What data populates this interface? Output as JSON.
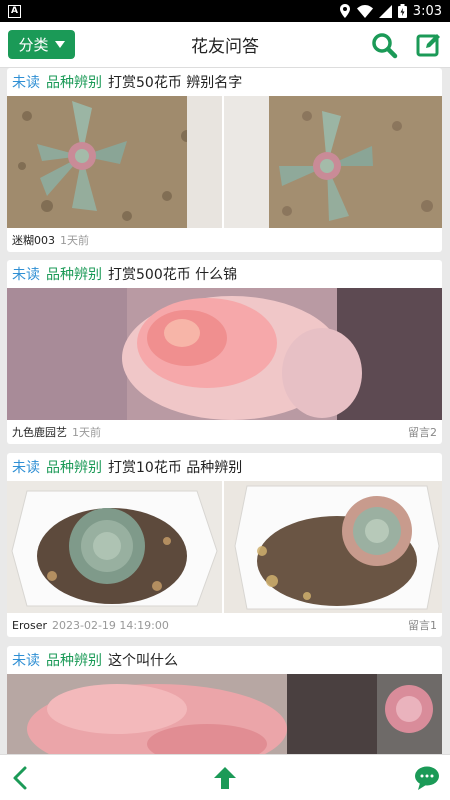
{
  "status_bar": {
    "left_badge": "A",
    "time": "3:03"
  },
  "header": {
    "category_label": "分类",
    "title": "花友问答"
  },
  "posts": [
    {
      "unread": "未读",
      "tag": "品种辨别",
      "title": "打赏50花币 辨别名字",
      "author": "迷糊003",
      "time": "1天前",
      "comments": ""
    },
    {
      "unread": "未读",
      "tag": "品种辨别",
      "title": "打赏500花币 什么锦",
      "author": "九色鹿园艺",
      "time": "1天前",
      "comments": "留言2"
    },
    {
      "unread": "未读",
      "tag": "品种辨别",
      "title": "打赏10花币 品种辨别",
      "author": "Eroser",
      "time": "2023-02-19 14:19:00",
      "comments": "留言1"
    },
    {
      "unread": "未读",
      "tag": "品种辨别",
      "title": "这个叫什么",
      "author": "",
      "time": "",
      "comments": ""
    }
  ],
  "colors": {
    "brand_green": "#1b9a57",
    "unread_blue": "#2f8fd4",
    "statusbar": "#000000",
    "feed_bg": "#e9e9e9"
  },
  "icons": {
    "search": "search-icon",
    "compose": "compose-icon",
    "back": "back-arrow-icon",
    "top": "scroll-top-icon",
    "chat": "chat-bubble-icon"
  }
}
